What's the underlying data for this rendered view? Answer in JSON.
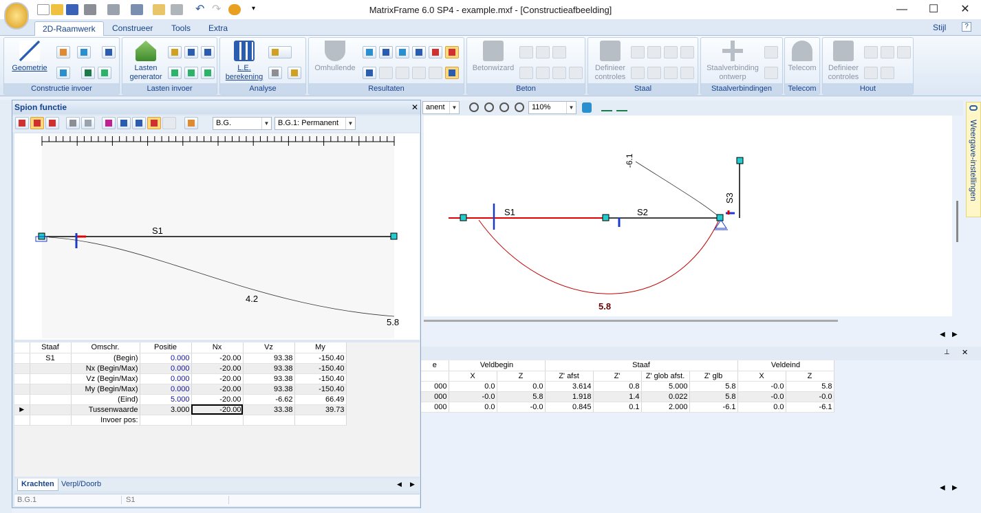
{
  "window": {
    "title": "MatrixFrame 6.0 SP4 - example.mxf - [Constructieafbeelding]"
  },
  "tabs": [
    "2D-Raamwerk",
    "Construeer",
    "Tools",
    "Extra"
  ],
  "style_menu": "Stijl",
  "ribbon": {
    "geometry": "Geometrie",
    "group_constructie": "Constructie invoer",
    "lasten_generator": "Lasten generator",
    "group_lasten": "Lasten invoer",
    "le_berekening": "L.E. berekening",
    "group_analyse": "Analyse",
    "omhullende": "Omhullende",
    "group_resultaten": "Resultaten",
    "betonwizard": "Betonwizard",
    "group_beton": "Beton",
    "definieer_controles": "Definieer controles",
    "group_staal": "Staal",
    "staalverbinding_ontwerp": "Staalverbinding ontwerp",
    "group_staalverbindingen": "Staalverbindingen",
    "telecom": "Telecom",
    "group_telecom": "Telecom",
    "definieer_controles_hout": "Definieer controles",
    "group_hout": "Hout"
  },
  "spion": {
    "title": "Spion functie",
    "combo_bg": "B.G.",
    "combo_case": "B.G.1: Permanent",
    "plot": {
      "member": "S1",
      "label_mid": "4.2",
      "label_end": "5.8"
    },
    "columns": [
      "Staaf",
      "Omschr.",
      "Positie",
      "Nx",
      "Vz",
      "My"
    ],
    "rows": [
      {
        "staaf": "S1",
        "omschr": "(Begin)",
        "positie": "0.000",
        "nx": "-20.00",
        "vz": "93.38",
        "my": "-150.40"
      },
      {
        "staaf": "",
        "omschr": "Nx (Begin/Max)",
        "positie": "0.000",
        "nx": "-20.00",
        "vz": "93.38",
        "my": "-150.40"
      },
      {
        "staaf": "",
        "omschr": "Vz (Begin/Max)",
        "positie": "0.000",
        "nx": "-20.00",
        "vz": "93.38",
        "my": "-150.40"
      },
      {
        "staaf": "",
        "omschr": "My (Begin/Max)",
        "positie": "0.000",
        "nx": "-20.00",
        "vz": "93.38",
        "my": "-150.40"
      },
      {
        "staaf": "",
        "omschr": "(Eind)",
        "positie": "5.000",
        "nx": "-20.00",
        "vz": "-6.62",
        "my": "66.49"
      },
      {
        "staaf": "",
        "omschr": "Tussenwaarde",
        "positie": "3.000",
        "nx": "-20.00",
        "vz": "33.38",
        "my": "39.73"
      },
      {
        "staaf": "",
        "omschr": "Invoer pos:",
        "positie": "",
        "nx": "",
        "vz": "",
        "my": ""
      }
    ],
    "bottom_tabs": [
      "Krachten",
      "Verpl/Doorb"
    ],
    "status": [
      "B.G.1",
      "S1"
    ]
  },
  "main": {
    "combo_case_partial": "anent",
    "zoom": "110%",
    "labels": {
      "s1": "S1",
      "s2": "S2",
      "s3": "S3",
      "max": "5.8",
      "neg": "-6.1"
    },
    "right_strip": "Weergave-instellingen"
  },
  "lower_table": {
    "group_headers": [
      "Veldbegin",
      "Staaf",
      "Veldeind"
    ],
    "columns": [
      "X",
      "Z",
      "Z' afst",
      "Z'",
      "Z' glob afst.",
      "Z' glb",
      "X",
      "Z"
    ],
    "rows": [
      {
        "c0": "000",
        "x1": "0.0",
        "z1": "0.0",
        "za": "3.614",
        "zp": "0.8",
        "zg": "5.000",
        "zgl": "5.8",
        "x2": "-0.0",
        "z2": "5.8"
      },
      {
        "c0": "000",
        "x1": "-0.0",
        "z1": "5.8",
        "za": "1.918",
        "zp": "1.4",
        "zg": "0.022",
        "zgl": "5.8",
        "x2": "-0.0",
        "z2": "-0.0"
      },
      {
        "c0": "000",
        "x1": "0.0",
        "z1": "-0.0",
        "za": "0.845",
        "zp": "0.1",
        "zg": "2.000",
        "zgl": "-6.1",
        "x2": "0.0",
        "z2": "-6.1"
      }
    ]
  },
  "colors": {
    "accent": "#15428b",
    "member": "#d00000",
    "node": "#22cccc"
  }
}
